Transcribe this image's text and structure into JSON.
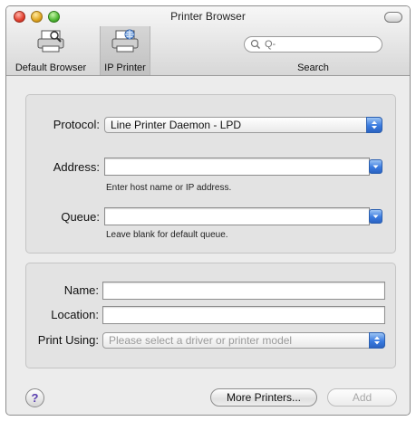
{
  "window": {
    "title": "Printer Browser"
  },
  "toolbar": {
    "default_browser_label": "Default Browser",
    "ip_printer_label": "IP Printer",
    "search_label": "Search",
    "search_value": "",
    "search_prefix": "Q-"
  },
  "form": {
    "protocol_label": "Protocol:",
    "protocol_value": "Line Printer Daemon - LPD",
    "address_label": "Address:",
    "address_value": "",
    "address_hint": "Enter host name or IP address.",
    "queue_label": "Queue:",
    "queue_value": "",
    "queue_hint": "Leave blank for default queue."
  },
  "details": {
    "name_label": "Name:",
    "name_value": "",
    "location_label": "Location:",
    "location_value": "",
    "print_using_label": "Print Using:",
    "print_using_value": "Please select a driver or printer model"
  },
  "footer": {
    "help_label": "?",
    "more_printers_label": "More Printers...",
    "add_label": "Add"
  },
  "colors": {
    "accent": "#3a7be0",
    "window_bg": "#ececec",
    "group_bg": "#e3e3e3"
  }
}
